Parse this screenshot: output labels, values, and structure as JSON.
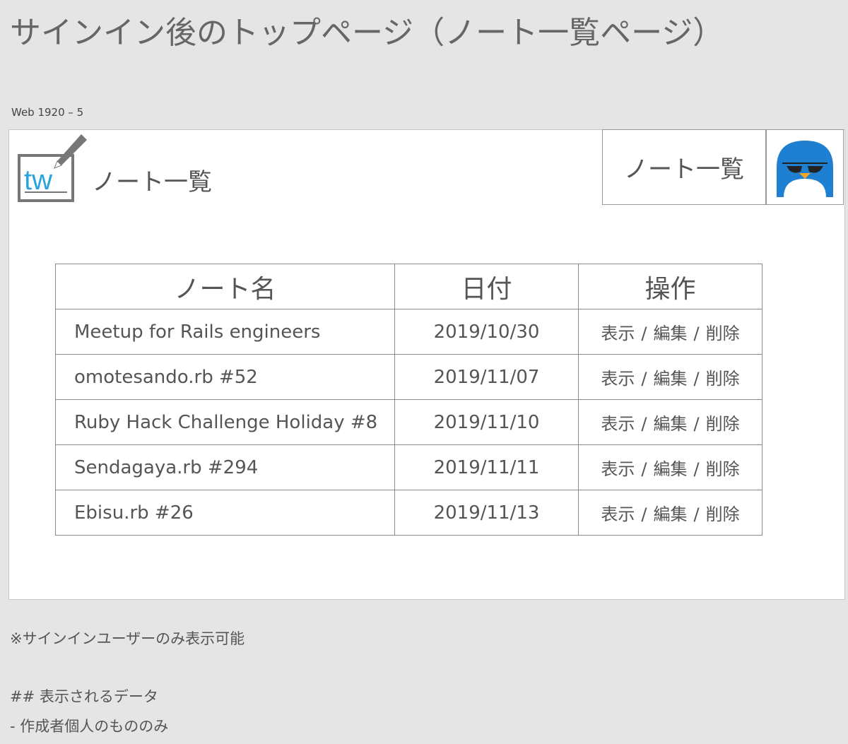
{
  "page": {
    "heading": "サインイン後のトップページ（ノート一覧ページ）",
    "artboard_label": "Web 1920 – 5"
  },
  "header": {
    "logo_text": "tw",
    "brand_title": "ノート一覧",
    "nav_link": "ノート一覧"
  },
  "table": {
    "headers": [
      "ノート名",
      "日付",
      "操作"
    ],
    "rows": [
      {
        "name": "Meetup for Rails engineers",
        "date": "2019/10/30"
      },
      {
        "name": "omotesando.rb #52",
        "date": "2019/11/07"
      },
      {
        "name": "Ruby Hack Challenge Holiday #8",
        "date": "2019/11/10"
      },
      {
        "name": "Sendagaya.rb #294",
        "date": "2019/11/11"
      },
      {
        "name": "Ebisu.rb #26",
        "date": "2019/11/13"
      }
    ],
    "ops": {
      "show": "表示",
      "edit": "編集",
      "delete": "削除",
      "separator": "/"
    }
  },
  "notes": {
    "line1": "※サインインユーザーのみ表示可能",
    "line2": "## 表示されるデータ",
    "line3": "- 作成者個人のもののみ"
  },
  "colors": {
    "background": "#e5e5e5",
    "logo_blue": "#29a3e0",
    "avatar_blue": "#1f7fd0"
  }
}
